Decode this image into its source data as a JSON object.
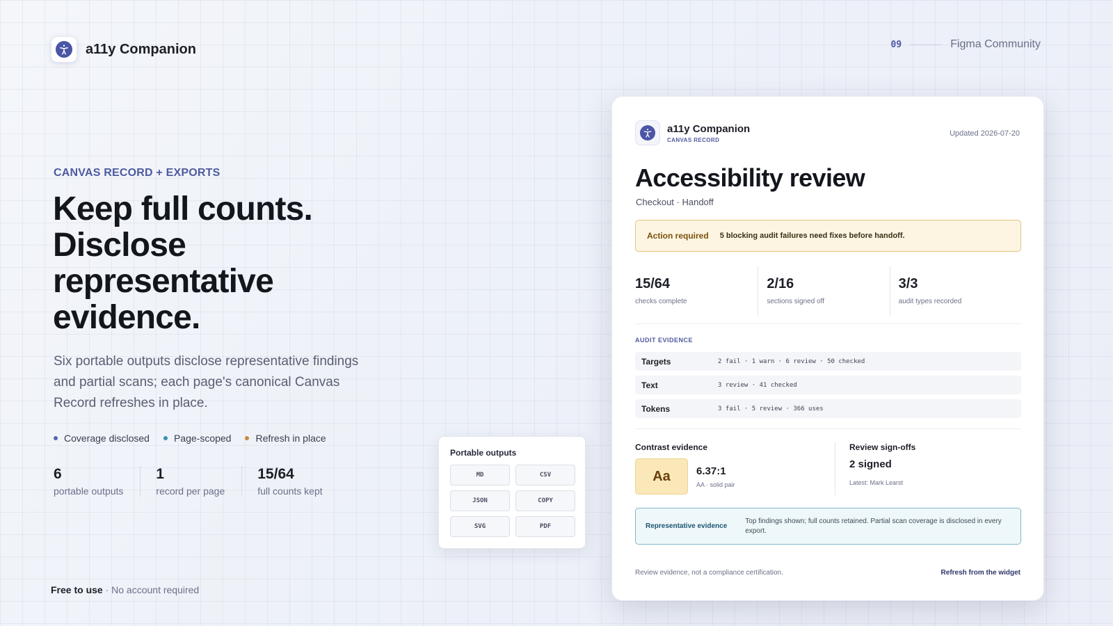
{
  "brand": {
    "name": "a11y Companion",
    "icon": "accessibility-icon"
  },
  "topbar": {
    "page_number": "09",
    "community": "Figma Community"
  },
  "hero": {
    "eyebrow": "CANVAS RECORD + EXPORTS",
    "headline": "Keep full counts. Disclose representative evidence.",
    "lead": "Six portable outputs disclose representative findings and partial scans; each page's canonical Canvas Record refreshes in place.",
    "chips": [
      {
        "label": "Coverage disclosed",
        "color": "#5a63b0"
      },
      {
        "label": "Page-scoped",
        "color": "#3b8fb0"
      },
      {
        "label": "Refresh in place",
        "color": "#c98a3a"
      }
    ],
    "stats": [
      {
        "value": "6",
        "label": "portable outputs"
      },
      {
        "value": "1",
        "label": "record per page"
      },
      {
        "value": "15/64",
        "label": "full counts kept"
      }
    ]
  },
  "footer": {
    "strong": "Free to use",
    "rest": " · No account required"
  },
  "outputs": {
    "title": "Portable outputs",
    "formats": [
      "MD",
      "CSV",
      "JSON",
      "COPY",
      "SVG",
      "PDF"
    ]
  },
  "review": {
    "app_name": "a11y Companion",
    "app_tag": "CANVAS RECORD",
    "updated": "Updated 2026-07-20",
    "title": "Accessibility review",
    "subtitle": "Checkout · Handoff",
    "alert": {
      "label": "Action required",
      "text": "5 blocking audit failures need fixes before handoff."
    },
    "kpis": [
      {
        "value": "15/64",
        "label": "checks complete"
      },
      {
        "value": "2/16",
        "label": "sections signed off"
      },
      {
        "value": "3/3",
        "label": "audit types recorded"
      }
    ],
    "evidence_title": "AUDIT EVIDENCE",
    "evidence": [
      {
        "name": "Targets",
        "summary": "2 fail · 1 warn · 6 review · 50 checked"
      },
      {
        "name": "Text",
        "summary": "3 review · 41 checked"
      },
      {
        "name": "Tokens",
        "summary": "3 fail · 5 review · 366 uses"
      }
    ],
    "contrast": {
      "title": "Contrast evidence",
      "sample": "Aa",
      "ratio": "6.37:1",
      "note": "AA · solid pair"
    },
    "signoffs": {
      "title": "Review sign-offs",
      "count": "2 signed",
      "latest": "Latest: Mark Learst"
    },
    "representative": {
      "label": "Representative evidence",
      "text": "Top findings shown; full counts retained. Partial scan coverage is disclosed in every export."
    },
    "footer_note": "Review evidence, not a compliance certification.",
    "footer_link": "Refresh from the widget"
  }
}
